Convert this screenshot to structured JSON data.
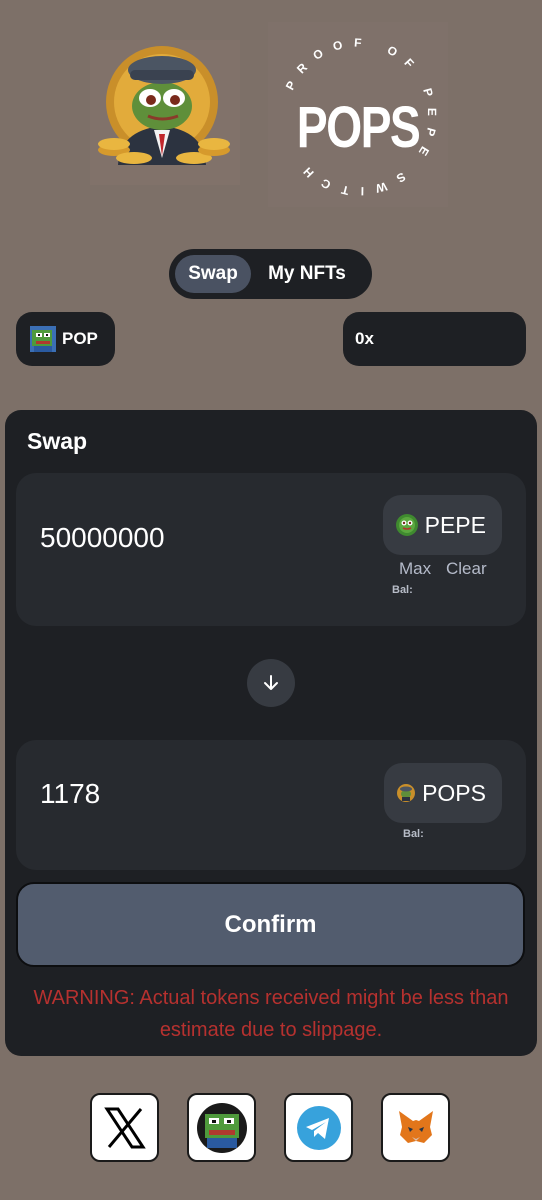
{
  "header": {
    "left_logo_icon": "pepe-coin-logo-icon",
    "right_logo_text": "POPS",
    "right_logo_ring_text": "PROOF OF PEPE SWITCH"
  },
  "tabs": [
    {
      "label": "Swap",
      "active": true
    },
    {
      "label": "My NFTs",
      "active": false
    }
  ],
  "token_chip": {
    "label": "POP",
    "icon": "pepe-pixel-icon"
  },
  "wallet_chip": {
    "label": "0x"
  },
  "swap": {
    "title": "Swap",
    "from": {
      "amount": "50000000",
      "token": "PEPE",
      "token_icon": "pepe-token-icon",
      "max_label": "Max",
      "clear_label": "Clear",
      "balance_label": "Bal:"
    },
    "direction_icon": "arrow-down-icon",
    "to": {
      "amount": "1178",
      "token": "POPS",
      "token_icon": "pops-token-icon",
      "balance_label": "Bal:"
    },
    "confirm_label": "Confirm",
    "warning": "WARNING: Actual tokens received might be less than estimate due to slippage."
  },
  "footer": {
    "links": [
      {
        "name": "x-icon"
      },
      {
        "name": "pepe-icon"
      },
      {
        "name": "telegram-icon"
      },
      {
        "name": "metamask-icon"
      }
    ]
  },
  "colors": {
    "background": "#7d7068",
    "card": "#1e2024",
    "panel": "#272a2f",
    "confirm": "#525c6e",
    "warning": "#b6312f"
  }
}
